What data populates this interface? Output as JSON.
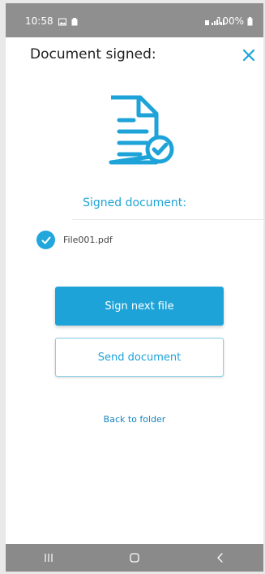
{
  "status_bar": {
    "time": "10:58",
    "battery": "100%"
  },
  "header": {
    "title": "Document signed:"
  },
  "main": {
    "signed_label": "Signed document:",
    "file_name": "File001.pdf",
    "primary_button": "Sign next file",
    "secondary_button": "Send document",
    "back_link": "Back to folder"
  },
  "icons": {
    "gallery": "image-icon",
    "notification": "clipboard-icon",
    "signal": "signal-icon",
    "battery": "battery-icon",
    "close": "close-icon",
    "document": "signed-document-icon",
    "check": "check-icon",
    "nav_recent": "recent-apps-icon",
    "nav_home": "home-icon",
    "nav_back": "back-icon"
  },
  "colors": {
    "accent": "#1ea3d8",
    "link": "#1785bf",
    "status_bar": "#8f8f8f",
    "nav_bar": "#8a8a8a"
  }
}
